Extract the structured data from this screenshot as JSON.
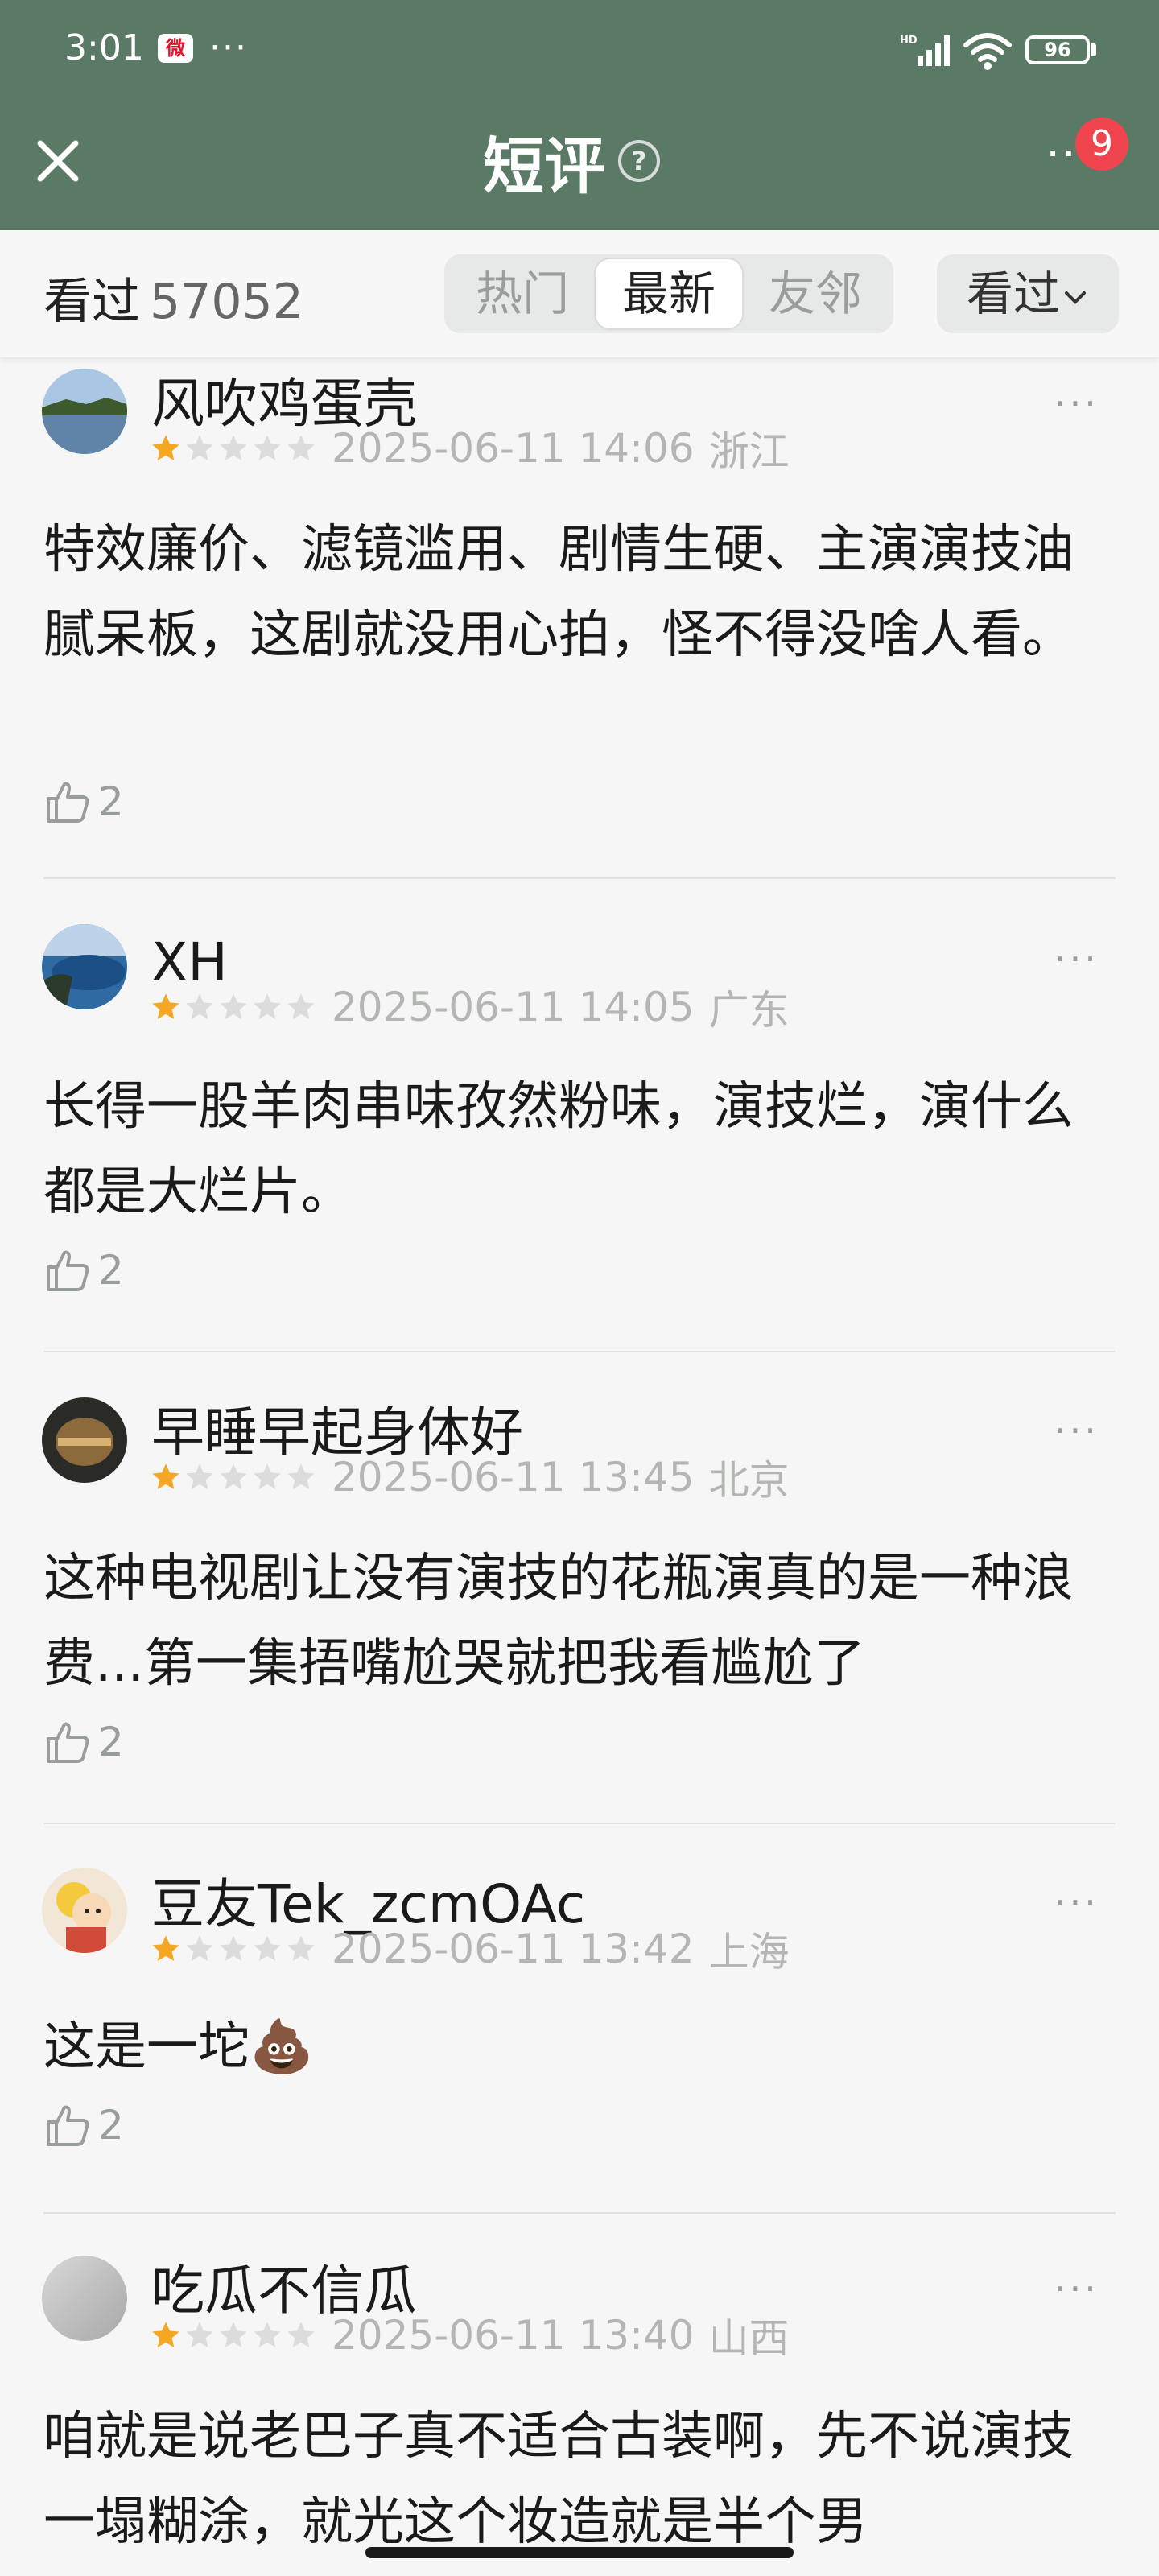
{
  "status_bar": {
    "time": "3:01",
    "more": "···",
    "battery": "96",
    "weibo_icon": "weibo-icon",
    "signal_icon": "signal-icon",
    "wifi_icon": "wifi-icon"
  },
  "header": {
    "title": "短评",
    "help": "?",
    "more": "··",
    "badge": "9"
  },
  "filter": {
    "seen_label": "看过",
    "seen_count": "57052",
    "tabs": [
      "热门",
      "最新",
      "友邻"
    ],
    "active_tab": "最新",
    "seen_filter": "看过"
  },
  "comments": [
    {
      "user": "风吹鸡蛋壳",
      "rating": 1,
      "datetime": "2025-06-11 14:06",
      "location": "浙江",
      "text": "特效廉价、滤镜滥用、剧情生硬、主演演技油腻呆板，这剧就没用心拍，怪不得没啥人看。",
      "likes": "2"
    },
    {
      "user": "XH",
      "rating": 1,
      "datetime": "2025-06-11 14:05",
      "location": "广东",
      "text": "长得一股羊肉串味孜然粉味，演技烂，演什么都是大烂片。",
      "likes": "2"
    },
    {
      "user": "早睡早起身体好",
      "rating": 1,
      "datetime": "2025-06-11 13:45",
      "location": "北京",
      "text": "这种电视剧让没有演技的花瓶演真的是一种浪费...第一集捂嘴尬哭就把我看尴尬了",
      "likes": "2"
    },
    {
      "user": "豆友Tek_zcmOAc",
      "rating": 1,
      "datetime": "2025-06-11 13:42",
      "location": "上海",
      "text": "这是一坨💩",
      "likes": "2"
    },
    {
      "user": "吃瓜不信瓜",
      "rating": 1,
      "datetime": "2025-06-11 13:40",
      "location": "山西",
      "text": "咱就是说老巴子真不适合古装啊，先不说演技一塌糊涂，就光这个妆造就是半个男",
      "likes": ""
    }
  ],
  "colors": {
    "header_bg": "#5b7a66",
    "star_on": "#f5a623",
    "star_off": "#dcdcdc",
    "badge": "#f0444f"
  }
}
